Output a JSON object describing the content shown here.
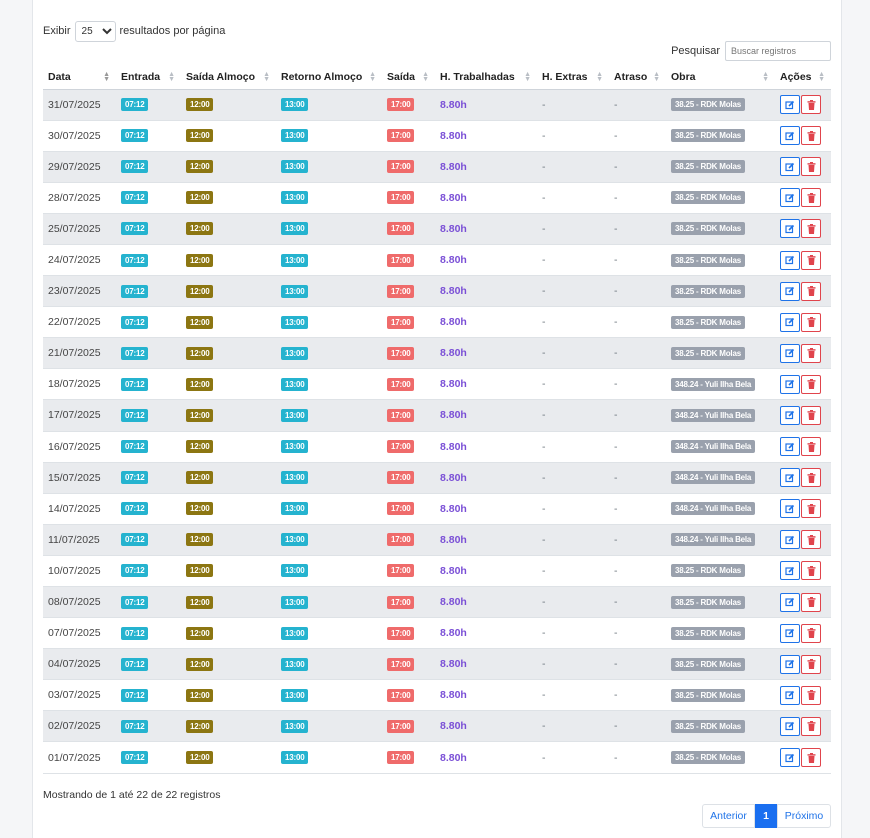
{
  "controls": {
    "show_label": "Exibir",
    "per_page": "25",
    "per_page_suffix": "resultados por página",
    "search_label": "Pesquisar",
    "search_placeholder": "Buscar registros"
  },
  "columns": [
    "Data",
    "Entrada",
    "Saída Almoço",
    "Retorno Almoço",
    "Saída",
    "H. Trabalhadas",
    "H. Extras",
    "Atraso",
    "Obra",
    "Ações"
  ],
  "rows": [
    {
      "data": "31/07/2025",
      "entrada": "07:12",
      "saida_almoco": "12:00",
      "retorno_almoco": "13:00",
      "saida": "17:00",
      "horas": "8.80h",
      "extras": "-",
      "atraso": "-",
      "obra": "38.25 - RDK Molas"
    },
    {
      "data": "30/07/2025",
      "entrada": "07:12",
      "saida_almoco": "12:00",
      "retorno_almoco": "13:00",
      "saida": "17:00",
      "horas": "8.80h",
      "extras": "-",
      "atraso": "-",
      "obra": "38.25 - RDK Molas"
    },
    {
      "data": "29/07/2025",
      "entrada": "07:12",
      "saida_almoco": "12:00",
      "retorno_almoco": "13:00",
      "saida": "17:00",
      "horas": "8.80h",
      "extras": "-",
      "atraso": "-",
      "obra": "38.25 - RDK Molas"
    },
    {
      "data": "28/07/2025",
      "entrada": "07:12",
      "saida_almoco": "12:00",
      "retorno_almoco": "13:00",
      "saida": "17:00",
      "horas": "8.80h",
      "extras": "-",
      "atraso": "-",
      "obra": "38.25 - RDK Molas"
    },
    {
      "data": "25/07/2025",
      "entrada": "07:12",
      "saida_almoco": "12:00",
      "retorno_almoco": "13:00",
      "saida": "17:00",
      "horas": "8.80h",
      "extras": "-",
      "atraso": "-",
      "obra": "38.25 - RDK Molas"
    },
    {
      "data": "24/07/2025",
      "entrada": "07:12",
      "saida_almoco": "12:00",
      "retorno_almoco": "13:00",
      "saida": "17:00",
      "horas": "8.80h",
      "extras": "-",
      "atraso": "-",
      "obra": "38.25 - RDK Molas"
    },
    {
      "data": "23/07/2025",
      "entrada": "07:12",
      "saida_almoco": "12:00",
      "retorno_almoco": "13:00",
      "saida": "17:00",
      "horas": "8.80h",
      "extras": "-",
      "atraso": "-",
      "obra": "38.25 - RDK Molas"
    },
    {
      "data": "22/07/2025",
      "entrada": "07:12",
      "saida_almoco": "12:00",
      "retorno_almoco": "13:00",
      "saida": "17:00",
      "horas": "8.80h",
      "extras": "-",
      "atraso": "-",
      "obra": "38.25 - RDK Molas"
    },
    {
      "data": "21/07/2025",
      "entrada": "07:12",
      "saida_almoco": "12:00",
      "retorno_almoco": "13:00",
      "saida": "17:00",
      "horas": "8.80h",
      "extras": "-",
      "atraso": "-",
      "obra": "38.25 - RDK Molas"
    },
    {
      "data": "18/07/2025",
      "entrada": "07:12",
      "saida_almoco": "12:00",
      "retorno_almoco": "13:00",
      "saida": "17:00",
      "horas": "8.80h",
      "extras": "-",
      "atraso": "-",
      "obra": "348.24 - Yuli Ilha Bela"
    },
    {
      "data": "17/07/2025",
      "entrada": "07:12",
      "saida_almoco": "12:00",
      "retorno_almoco": "13:00",
      "saida": "17:00",
      "horas": "8.80h",
      "extras": "-",
      "atraso": "-",
      "obra": "348.24 - Yuli Ilha Bela"
    },
    {
      "data": "16/07/2025",
      "entrada": "07:12",
      "saida_almoco": "12:00",
      "retorno_almoco": "13:00",
      "saida": "17:00",
      "horas": "8.80h",
      "extras": "-",
      "atraso": "-",
      "obra": "348.24 - Yuli Ilha Bela"
    },
    {
      "data": "15/07/2025",
      "entrada": "07:12",
      "saida_almoco": "12:00",
      "retorno_almoco": "13:00",
      "saida": "17:00",
      "horas": "8.80h",
      "extras": "-",
      "atraso": "-",
      "obra": "348.24 - Yuli Ilha Bela"
    },
    {
      "data": "14/07/2025",
      "entrada": "07:12",
      "saida_almoco": "12:00",
      "retorno_almoco": "13:00",
      "saida": "17:00",
      "horas": "8.80h",
      "extras": "-",
      "atraso": "-",
      "obra": "348.24 - Yuli Ilha Bela"
    },
    {
      "data": "11/07/2025",
      "entrada": "07:12",
      "saida_almoco": "12:00",
      "retorno_almoco": "13:00",
      "saida": "17:00",
      "horas": "8.80h",
      "extras": "-",
      "atraso": "-",
      "obra": "348.24 - Yuli Ilha Bela"
    },
    {
      "data": "10/07/2025",
      "entrada": "07:12",
      "saida_almoco": "12:00",
      "retorno_almoco": "13:00",
      "saida": "17:00",
      "horas": "8.80h",
      "extras": "-",
      "atraso": "-",
      "obra": "38.25 - RDK Molas"
    },
    {
      "data": "08/07/2025",
      "entrada": "07:12",
      "saida_almoco": "12:00",
      "retorno_almoco": "13:00",
      "saida": "17:00",
      "horas": "8.80h",
      "extras": "-",
      "atraso": "-",
      "obra": "38.25 - RDK Molas"
    },
    {
      "data": "07/07/2025",
      "entrada": "07:12",
      "saida_almoco": "12:00",
      "retorno_almoco": "13:00",
      "saida": "17:00",
      "horas": "8.80h",
      "extras": "-",
      "atraso": "-",
      "obra": "38.25 - RDK Molas"
    },
    {
      "data": "04/07/2025",
      "entrada": "07:12",
      "saida_almoco": "12:00",
      "retorno_almoco": "13:00",
      "saida": "17:00",
      "horas": "8.80h",
      "extras": "-",
      "atraso": "-",
      "obra": "38.25 - RDK Molas"
    },
    {
      "data": "03/07/2025",
      "entrada": "07:12",
      "saida_almoco": "12:00",
      "retorno_almoco": "13:00",
      "saida": "17:00",
      "horas": "8.80h",
      "extras": "-",
      "atraso": "-",
      "obra": "38.25 - RDK Molas"
    },
    {
      "data": "02/07/2025",
      "entrada": "07:12",
      "saida_almoco": "12:00",
      "retorno_almoco": "13:00",
      "saida": "17:00",
      "horas": "8.80h",
      "extras": "-",
      "atraso": "-",
      "obra": "38.25 - RDK Molas"
    },
    {
      "data": "01/07/2025",
      "entrada": "07:12",
      "saida_almoco": "12:00",
      "retorno_almoco": "13:00",
      "saida": "17:00",
      "horas": "8.80h",
      "extras": "-",
      "atraso": "-",
      "obra": "38.25 - RDK Molas"
    }
  ],
  "row_icons": {
    "edit": "edit-icon",
    "delete": "trash-icon"
  },
  "footer": {
    "info": "Mostrando de 1 até 22 de 22 registros"
  },
  "pagination": {
    "prev": "Anterior",
    "current": "1",
    "next": "Próximo"
  },
  "colors": {
    "entrada": "#25b3cf",
    "saida_almoco": "#8c7612",
    "retorno_almoco": "#25b3cf",
    "saida": "#ef6b6b",
    "obra": "#9aa1ad",
    "horas": "#7a4fd6",
    "primary": "#1a6ff0",
    "danger": "#e0444c"
  }
}
